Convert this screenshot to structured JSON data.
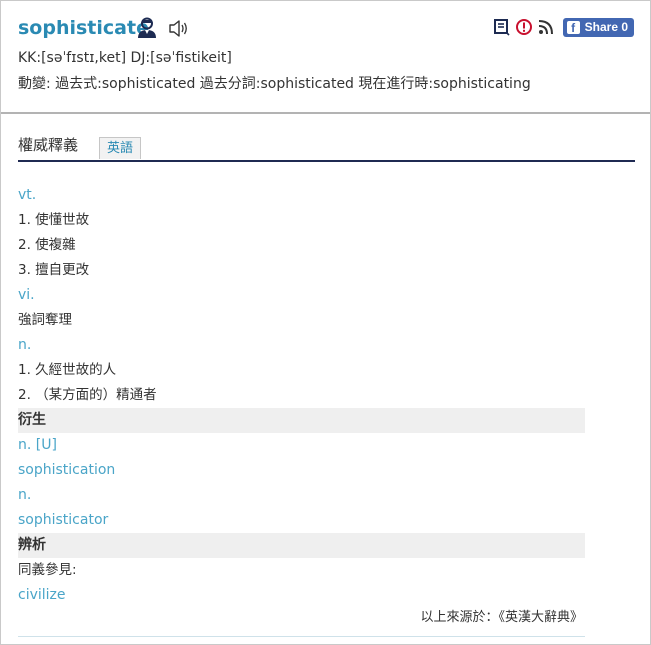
{
  "entry": {
    "headword": "sophisticate",
    "pronunciation": "KK:[səˈfɪstɪ,ket] DJ:[səˈfistikeit]",
    "inflections": "動變: 過去式:sophisticated  過去分詞:sophisticated  現在進行時:sophisticating"
  },
  "toolbar": {
    "share_label": "Share 0",
    "fb_glyph": "f"
  },
  "tabs": [
    {
      "label": "權威釋義"
    },
    {
      "label": "英語"
    }
  ],
  "definitions": {
    "rows": [
      {
        "type": "pos",
        "text": "vt."
      },
      {
        "type": "def",
        "text": "1. 使懂世故"
      },
      {
        "type": "def",
        "text": "2. 使複雜"
      },
      {
        "type": "def",
        "text": "3. 擅自更改"
      },
      {
        "type": "pos",
        "text": "vi."
      },
      {
        "type": "def",
        "text": "強詞奪理"
      },
      {
        "type": "pos",
        "text": "n."
      },
      {
        "type": "def",
        "text": "1. 久經世故的人"
      },
      {
        "type": "def",
        "text": "2. （某方面的）精通者"
      },
      {
        "type": "section",
        "text": "衍生"
      },
      {
        "type": "pos",
        "text": "n. [U]"
      },
      {
        "type": "link",
        "text": "sophistication"
      },
      {
        "type": "pos",
        "text": "n."
      },
      {
        "type": "link",
        "text": "sophisticator"
      },
      {
        "type": "section",
        "text": "辨析"
      },
      {
        "type": "def",
        "text": "同義參見:"
      },
      {
        "type": "link",
        "text": "civilize"
      }
    ],
    "source": "以上來源於：《英漢大辭典》"
  },
  "icons": {
    "person": "person-icon",
    "speaker": "speaker-icon",
    "note": "note-icon",
    "report": "warning-icon",
    "rss": "rss-icon"
  },
  "colors": {
    "headword": "#2a8ab3",
    "pos": "#4aa5c8",
    "facebook": "#4267b2",
    "tab_rule": "#1f2a52",
    "section_bg": "#efefef"
  }
}
